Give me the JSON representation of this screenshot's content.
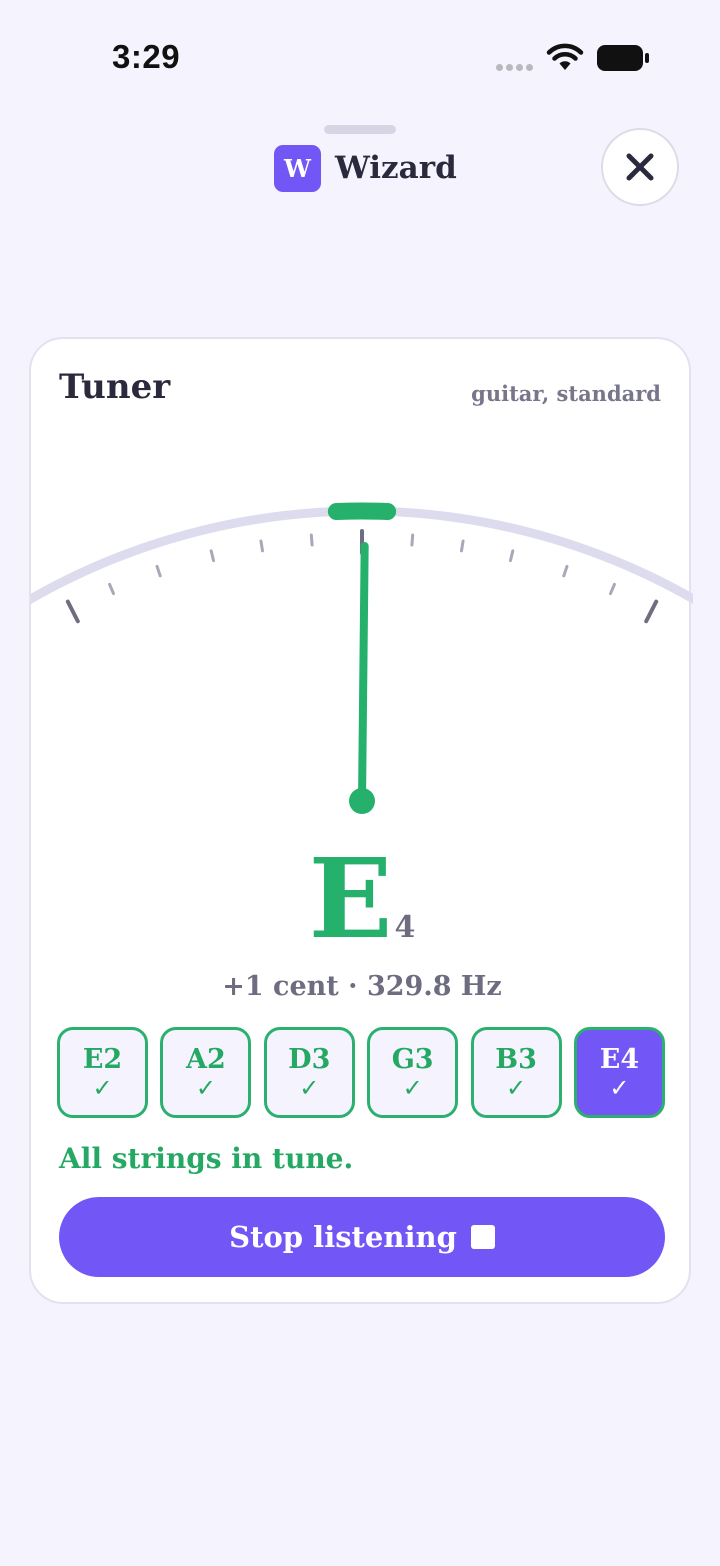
{
  "status_bar": {
    "time": "3:29",
    "wifi_icon": "wifi-icon",
    "battery_icon": "battery-icon"
  },
  "header": {
    "logo_letter": "W",
    "app_name": "Wizard",
    "close_icon": "close-icon"
  },
  "tuner": {
    "title": "Tuner",
    "subtitle": "guitar, standard",
    "needle_cents": 1,
    "gauge_range_cents": [
      -50,
      50
    ],
    "note": "E",
    "octave": "4",
    "readout": "+1 cent · 329.8 Hz",
    "strings": [
      {
        "label": "E2",
        "check": "✓",
        "active": false
      },
      {
        "label": "A2",
        "check": "✓",
        "active": false
      },
      {
        "label": "D3",
        "check": "✓",
        "active": false
      },
      {
        "label": "G3",
        "check": "✓",
        "active": false
      },
      {
        "label": "B3",
        "check": "✓",
        "active": false
      },
      {
        "label": "E4",
        "check": "✓",
        "active": true
      }
    ],
    "status_message": "All strings in tune.",
    "stop_button_label": "Stop listening",
    "stop_icon": "stop-icon"
  },
  "colors": {
    "accent": "#7357f6",
    "in_tune": "#25b06b",
    "background": "#f5f4fe"
  }
}
